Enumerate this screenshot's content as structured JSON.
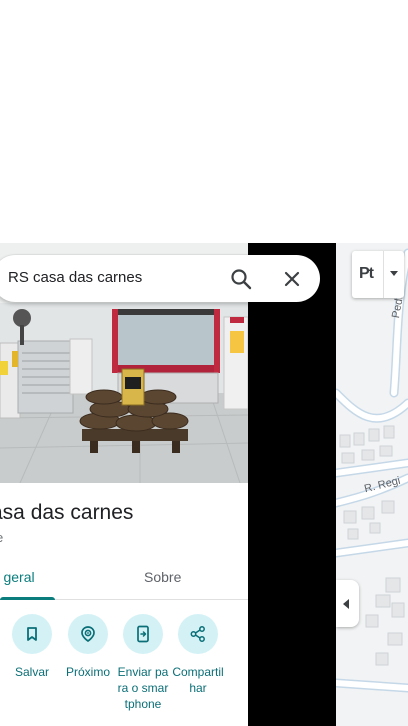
{
  "search": {
    "query": "RS casa das carnes"
  },
  "place": {
    "title": "asa das carnes",
    "category": "e"
  },
  "tabs": [
    {
      "label": "ão geral",
      "selected": true
    },
    {
      "label": "Sobre",
      "selected": false
    }
  ],
  "actions": [
    {
      "label": "Salvar",
      "icon": "bookmark-icon"
    },
    {
      "label": "Próximo",
      "icon": "nearby-icon"
    },
    {
      "label": "Enviar para o smartphone",
      "icon": "send-to-phone-icon"
    },
    {
      "label": "Compartilhar",
      "icon": "share-icon"
    }
  ],
  "map": {
    "layer_button_label": "Pt",
    "street_labels": [
      "Pedro",
      "R. Regi"
    ]
  },
  "colors": {
    "accent": "#0b7d7d",
    "action_circle": "#d4f2f6",
    "map_bg": "#f1f3f4",
    "road": "#ffffff",
    "road_outline": "#c5d8e8"
  }
}
